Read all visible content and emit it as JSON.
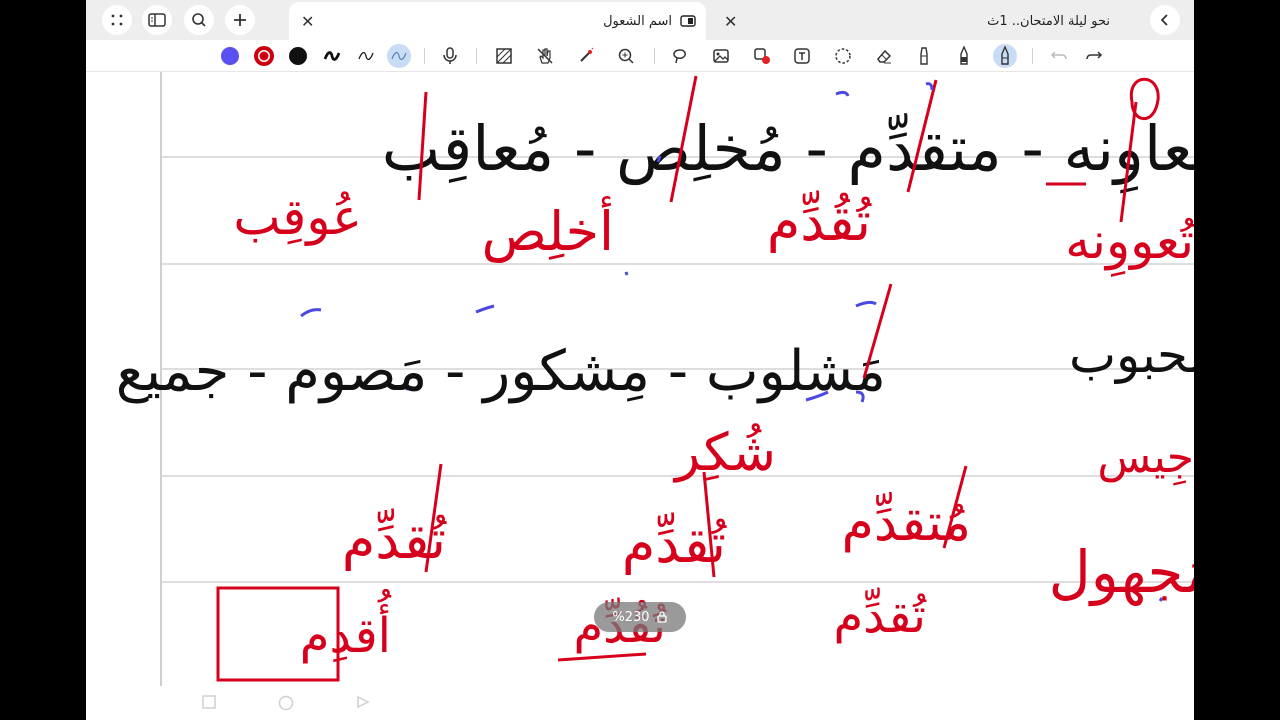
{
  "tabs": {
    "active": {
      "title": "اسم الشعول"
    },
    "second": {
      "title": "نحو ليلة الامتحان.. 1ث"
    }
  },
  "toolbar": {
    "pen_colors": [
      "#5a4ff0",
      "#cc0011",
      "#111111"
    ],
    "selected_tool": "pen"
  },
  "zoom": {
    "label": "%230"
  },
  "notes": {
    "ink_colors": {
      "black": "#111111",
      "red": "#d6001c",
      "blue": "#4a4ae0"
    },
    "black_lines": [
      "معاوِنه - متقدِّم - مُخلِص - مُعاقِب",
      "مَشلوب - مِشكور - مَصوم - جميع",
      "محبوب"
    ],
    "red_words": [
      "تُعووِنه",
      "تُقُدِّم",
      "أخلِص",
      "عُوقِب",
      "شُكِر",
      "مَجهول",
      "جِيس",
      "مُتقدِّم",
      "تُقدِّم",
      "تُقدِّم",
      "تُقدِّم",
      "تُقُدِّم",
      "أُقدِم"
    ]
  }
}
